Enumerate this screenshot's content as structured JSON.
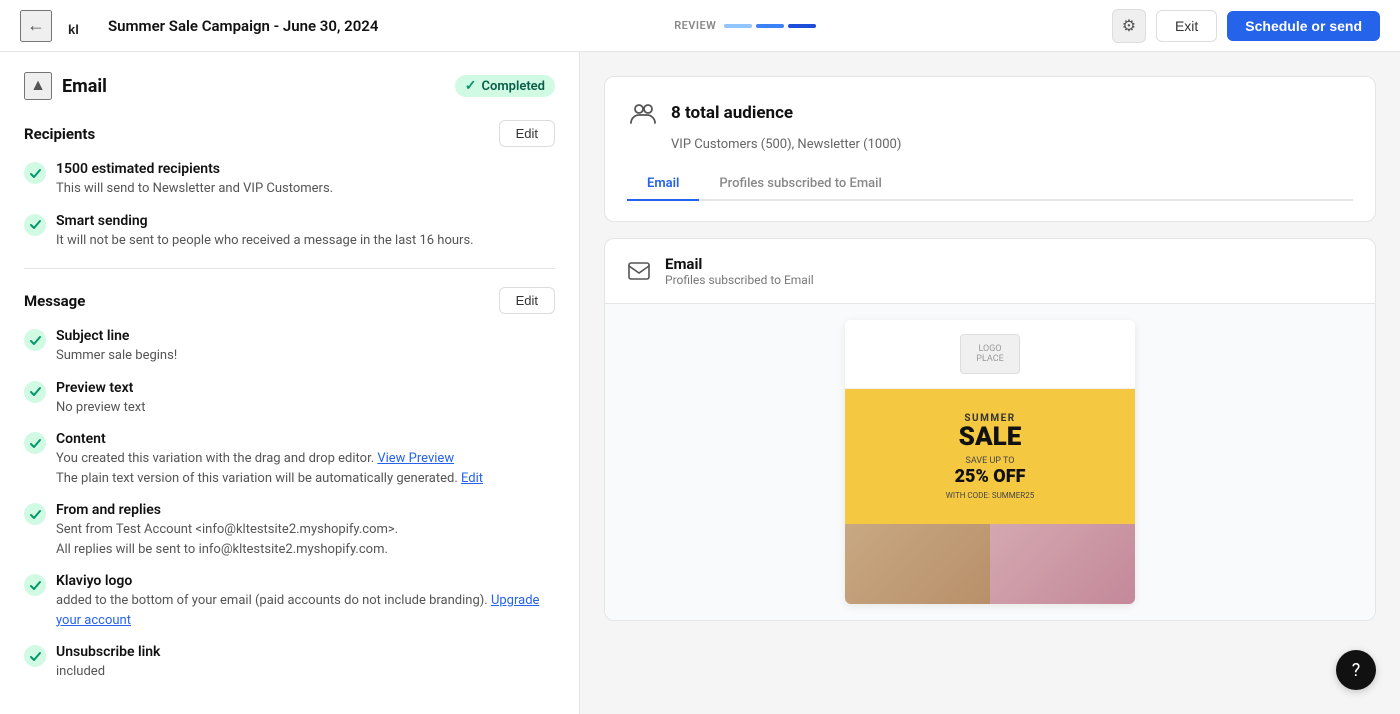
{
  "nav": {
    "back_icon": "←",
    "logo_text": "klaviyo",
    "campaign_title": "Summer Sale Campaign - June 30, 2024",
    "review_label": "Review",
    "gear_icon": "⚙",
    "exit_label": "Exit",
    "schedule_label": "Schedule or send",
    "progress": [
      {
        "color": "#2563eb",
        "filled": true
      },
      {
        "color": "#2563eb",
        "filled": true
      },
      {
        "color": "#2563eb",
        "filled": true
      },
      {
        "color": "#2563eb",
        "filled": true
      }
    ]
  },
  "left": {
    "collapse_icon": "▲",
    "email_label": "Email",
    "completed_label": "Completed",
    "recipients_title": "Recipients",
    "edit_recipients_label": "Edit",
    "recipients_items": [
      {
        "id": "estimated",
        "title": "1500 estimated recipients",
        "desc": "This will send to Newsletter and VIP Customers."
      },
      {
        "id": "smart-sending",
        "title": "Smart sending",
        "desc": "It will not be sent to people who received a message in the last 16 hours."
      }
    ],
    "message_title": "Message",
    "edit_message_label": "Edit",
    "message_items": [
      {
        "id": "subject-line",
        "title": "Subject line",
        "desc": "Summer sale begins!"
      },
      {
        "id": "preview-text",
        "title": "Preview text",
        "desc": "No preview text"
      },
      {
        "id": "content",
        "title": "Content",
        "desc_parts": [
          "You created this variation with the drag and drop editor. ",
          "View Preview",
          "\nThe plain text version of this variation will be automatically generated. ",
          "Edit"
        ]
      },
      {
        "id": "from-replies",
        "title": "From and replies",
        "desc": "Sent from Test Account <info@kltestsite2.myshopify.com>.\nAll replies will be sent to info@kltestsite2.myshopify.com."
      },
      {
        "id": "klaviyo-logo",
        "title": "Klaviyo logo",
        "desc_parts": [
          "added to the bottom of your email (paid accounts do not include branding). ",
          "Upgrade your account"
        ]
      },
      {
        "id": "unsubscribe-link",
        "title": "Unsubscribe link",
        "desc": "included"
      }
    ]
  },
  "right": {
    "audience_title": "8 total audience",
    "audience_subtitle": "VIP Customers (500), Newsletter (1000)",
    "audience_icon": "👥",
    "tabs": [
      {
        "label": "Email",
        "active": true
      },
      {
        "label": "Profiles subscribed to Email",
        "active": false
      }
    ],
    "email_card_title": "Email",
    "email_card_subtitle": "Profiles subscribed to Email",
    "email_mockup": {
      "logo_placeholder": "LOGO\nPLACE",
      "hero_label": "SUMMER",
      "hero_title": "SALE",
      "hero_sub": "SAVE UP TO",
      "hero_discount": "25% OFF",
      "hero_code": "WITH CODE: SUMMER25"
    }
  },
  "help": {
    "icon": "?"
  }
}
